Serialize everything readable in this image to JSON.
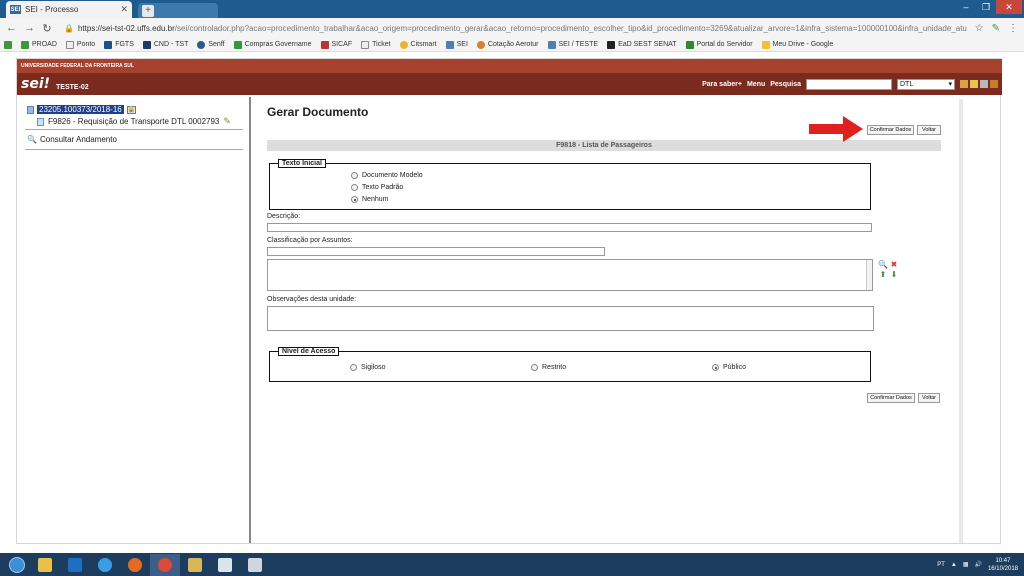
{
  "browser": {
    "tab_title": "SEI - Processo",
    "tab_favicon": "SEI",
    "url_host": "https://sei-tst-02.uffs.edu.br",
    "url_path": "/sei/controlador.php?acao=procedimento_trabalhar&acao_origem=procedimento_gerar&acao_retorno=procedimento_escolher_tipo&id_procedimento=3269&atualizar_arvore=1&infra_sistema=100000100&infra_unidade_atual=341&infra..."
  },
  "bookmarks": [
    "PROAD",
    "Ponto",
    "FGTS",
    "CND - TST",
    "Senff",
    "Compras Govername",
    "SICAF",
    "Ticket",
    "Citsmart",
    "SEI",
    "Cotação Aerotur",
    "SEI / TESTE",
    "EaD SEST SENAT",
    "Portal do Servidor",
    "Meu Drive - Google"
  ],
  "sei": {
    "institution": "UNIVERSIDADE FEDERAL DA FRONTEIRA SUL",
    "logo": "sei!",
    "unit": "TESTE-02",
    "para_saber": "Para saber+",
    "menu": "Menu",
    "pesquisa": "Pesquisa",
    "unit_select": "DTL"
  },
  "tree": {
    "process_number": "23205.100373/2018-16",
    "document": "F9826 - Requisição de Transporte DTL 0002793",
    "consultar": "Consultar Andamento"
  },
  "form": {
    "title": "Gerar Documento",
    "confirm_label": "Confirmar Dados",
    "back_label": "Voltar",
    "doc_type": "F9818 - Lista de Passageiros",
    "texto_inicial": {
      "legend": "Texto Inicial",
      "options": [
        "Documento Modelo",
        "Texto Padrão",
        "Nenhum"
      ],
      "selected": "Nenhum"
    },
    "descricao_label": "Descrição:",
    "classificacao_label": "Classificação por Assuntos:",
    "observacoes_label": "Observações desta unidade:",
    "nivel_acesso": {
      "legend": "Nível de Acesso",
      "options": [
        "Sigiloso",
        "Restrito",
        "Público"
      ],
      "selected": "Público"
    }
  },
  "taskbar": {
    "lang": "PT",
    "time": "10:47",
    "date": "16/10/2018"
  },
  "colors": {
    "sei_top": "#a5412d",
    "sei_header": "#7b2b1d",
    "arrow": "#e0201f"
  }
}
